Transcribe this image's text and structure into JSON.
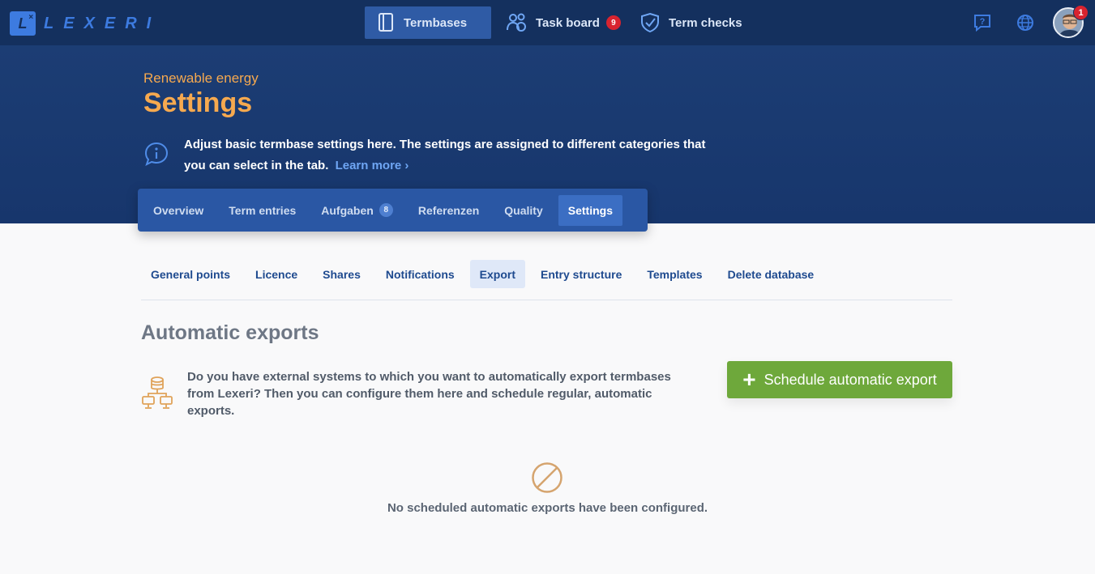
{
  "app": {
    "logo_mark": "L",
    "logo_name": "LEXERI"
  },
  "topnav": {
    "termbases": "Termbases",
    "task_board": "Task board",
    "task_board_count": "9",
    "term_checks": "Term checks",
    "avatar_count": "1"
  },
  "header": {
    "crumb": "Renewable energy",
    "title": "Settings",
    "info": "Adjust basic termbase settings here. The settings are assigned to different categories that you can select in the tab.",
    "learn_more": "Learn more ›"
  },
  "subtabs": {
    "overview": "Overview",
    "term_entries": "Term entries",
    "aufgaben": "Aufgaben",
    "aufgaben_count": "8",
    "referenzen": "Referenzen",
    "quality": "Quality",
    "settings": "Settings"
  },
  "settings_tabs": [
    "General points",
    "Licence",
    "Shares",
    "Notifications",
    "Export",
    "Entry structure",
    "Templates",
    "Delete database"
  ],
  "content": {
    "title": "Automatic exports",
    "description": "Do you have external systems to which you want to automatically export termbases from Lexeri? Then you can configure them here and schedule regular, automatic exports.",
    "schedule_button": "Schedule automatic export",
    "empty": "No scheduled automatic exports have been configured."
  },
  "colors": {
    "topbar": "#14305e",
    "header": "#1c3d74",
    "accent": "#f6a94f",
    "green": "#6ea83b",
    "link": "#6fa6f4"
  }
}
